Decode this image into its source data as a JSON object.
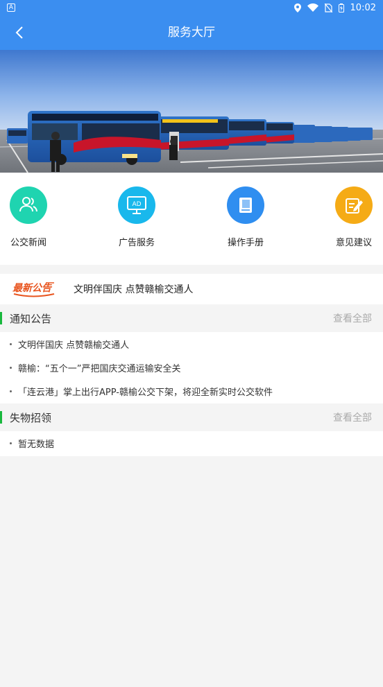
{
  "status_bar": {
    "left_icon": "A",
    "time": "10:02"
  },
  "header": {
    "title": "服务大厅",
    "back_icon": "chevron-left-icon"
  },
  "quick_menu": [
    {
      "label": "公交新闻",
      "icon": "users-icon",
      "color": "#1fd4b0"
    },
    {
      "label": "广告服务",
      "icon": "ad-screen-icon",
      "color": "#19b8ec"
    },
    {
      "label": "操作手册",
      "icon": "book-icon",
      "color": "#2f8ef0"
    },
    {
      "label": "意见建议",
      "icon": "edit-note-icon",
      "color": "#f5ab16"
    }
  ],
  "latest": {
    "badge": "最新公告",
    "text": "文明伴国庆 点赞赣榆交通人"
  },
  "notices": {
    "title": "通知公告",
    "more": "查看全部",
    "items": [
      "文明伴国庆 点赞赣榆交通人",
      "赣榆：“五个一”严把国庆交通运输安全关",
      "「连云港」掌上出行APP-赣榆公交下架，将迎全新实时公交软件"
    ]
  },
  "lost_found": {
    "title": "失物招领",
    "more": "查看全部",
    "items": [
      "暂无数据"
    ]
  },
  "colors": {
    "primary": "#3b8ef0",
    "section_accent": "#19b83e",
    "badge": "#e8541e"
  }
}
